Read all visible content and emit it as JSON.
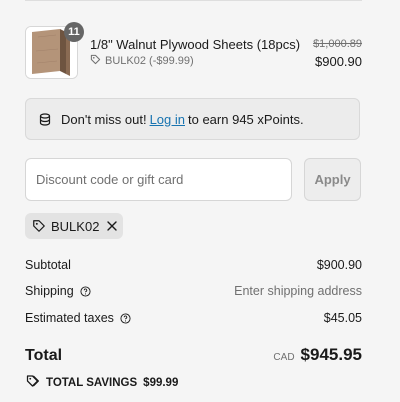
{
  "product": {
    "name": "1/8\" Walnut Plywood Sheets (18pcs)",
    "quantity": "11",
    "discount_code": "BULK02 (-$99.99)",
    "original_price": "$1,000.89",
    "price": "$900.90",
    "thumbnail_icon": "plywood-sheets-image"
  },
  "points_banner": {
    "prefix": "Don't miss out!",
    "link": "Log in",
    "suffix": "to earn 945 xPoints.",
    "icon": "database-icon"
  },
  "discount": {
    "placeholder": "Discount code or gift card",
    "value": "",
    "apply_label": "Apply",
    "applied_code": "BULK02"
  },
  "summary": {
    "subtotal_label": "Subtotal",
    "subtotal_value": "$900.90",
    "shipping_label": "Shipping",
    "shipping_value": "Enter shipping address",
    "taxes_label": "Estimated taxes",
    "taxes_value": "$45.05",
    "total_label": "Total",
    "currency": "CAD",
    "total_value": "$945.95",
    "savings_label": "TOTAL SAVINGS",
    "savings_value": "$99.99"
  },
  "colors": {
    "link": "#1773b0",
    "background": "#f5f5f5",
    "badge": "#666666"
  }
}
